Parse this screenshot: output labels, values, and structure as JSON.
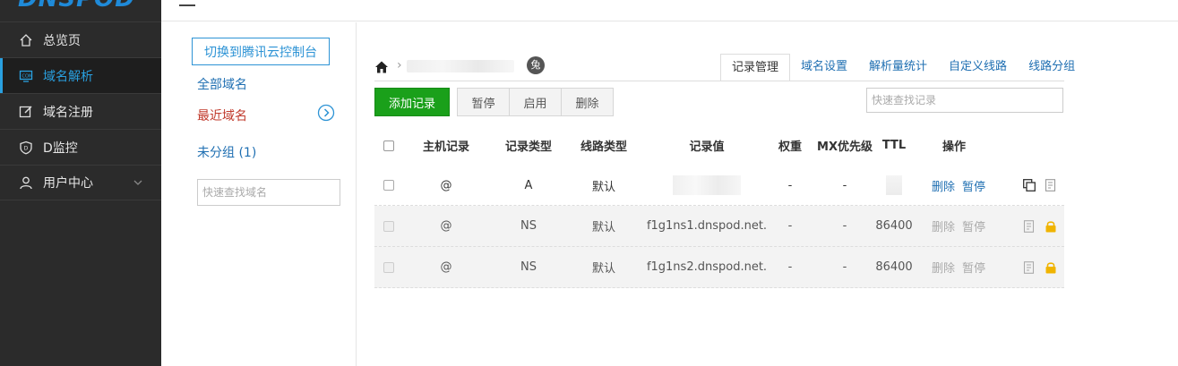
{
  "sidebar": {
    "logo": "DNSPOD",
    "items": [
      {
        "label": "总览页",
        "icon": "home-icon"
      },
      {
        "label": "域名解析",
        "icon": "dns-icon"
      },
      {
        "label": "域名注册",
        "icon": "edit-icon"
      },
      {
        "label": "D监控",
        "icon": "shield-icon"
      },
      {
        "label": "用户中心",
        "icon": "user-icon"
      }
    ],
    "active_index": 1
  },
  "domain_panel": {
    "switch_button": "切换到腾讯云控制台",
    "all_domains": "全部域名",
    "recent_domains": "最近域名",
    "ungrouped": "未分组 (1)",
    "search_placeholder": "快速查找域名"
  },
  "breadcrumb": {
    "badge": "兔"
  },
  "tabs": [
    "记录管理",
    "域名设置",
    "解析量统计",
    "自定义线路",
    "线路分组"
  ],
  "active_tab": 0,
  "toolbar": {
    "add": "添加记录",
    "pause": "暂停",
    "enable": "启用",
    "delete": "删除",
    "search_placeholder": "快速查找记录"
  },
  "table": {
    "headers": {
      "host": "主机记录",
      "type": "记录类型",
      "line": "线路类型",
      "value": "记录值",
      "weight": "权重",
      "mx": "MX优先级",
      "ttl": "TTL",
      "ops": "操作"
    },
    "rows": [
      {
        "host": "@",
        "type": "A",
        "line": "默认",
        "value": "",
        "weight": "-",
        "mx": "-",
        "ttl": "",
        "del": "删除",
        "pause": "暂停",
        "locked": false
      },
      {
        "host": "@",
        "type": "NS",
        "line": "默认",
        "value": "f1g1ns1.dnspod.net.",
        "weight": "-",
        "mx": "-",
        "ttl": "86400",
        "del": "删除",
        "pause": "暂停",
        "locked": true
      },
      {
        "host": "@",
        "type": "NS",
        "line": "默认",
        "value": "f1g1ns2.dnspod.net.",
        "weight": "-",
        "mx": "-",
        "ttl": "86400",
        "del": "删除",
        "pause": "暂停",
        "locked": true
      }
    ]
  },
  "colors": {
    "accent": "#29a0e0",
    "link": "#1f6fb2",
    "add_button": "#1aa01a",
    "recent": "#c0392b",
    "lock": "#f0b400"
  }
}
